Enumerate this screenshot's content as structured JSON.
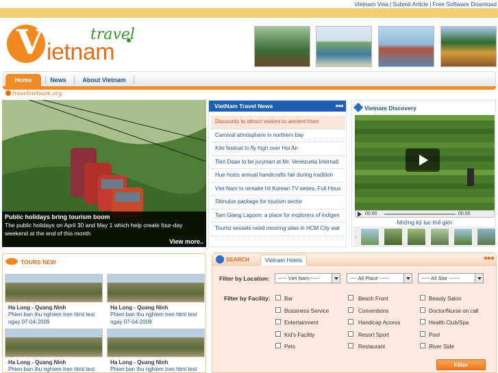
{
  "top_links": [
    "Vietnam Visa",
    "Submit Article",
    "Free Software Download"
  ],
  "top_link_separator": "|",
  "logo": {
    "letter": "V",
    "word": "ietnam",
    "tagline": "travel"
  },
  "nav": {
    "items": [
      "Home",
      "News",
      "About Vietnam"
    ],
    "site_url": "travelvietnam.org"
  },
  "featured": {
    "title": "Public holidays bring tourism boom",
    "description": "The public holidays on April 30 and May 1 which help create four-day weekend at the end of this month",
    "more": "View more.."
  },
  "news": {
    "title": "VietNam Travel News",
    "dots": "●●●",
    "items": [
      "Discounts to attract visitors to ancient town",
      "Carnival atmosphere in northern bay",
      "Kite festival to fly high over Hoi An",
      "Tien Doan to be juryman at Mr. Venezuela Internati",
      "Hue hosts annual handicrafts fair during tradition",
      "Viet Nam to remake hit Korean TV series, Full Hous",
      "Stimulus package for tourism sector",
      "Tam Giang Lagoon: a place for explorers of indigen",
      "Tourist vessels need mooring sites in HCM City wat"
    ]
  },
  "discovery": {
    "title": "Vietnam Discovery",
    "time_start": "00:00",
    "time_end": "00:00",
    "caption": "Những kỳ lục thế giới",
    "thumb_prev": "‹",
    "thumb_next": "›"
  },
  "tours": {
    "title": "TOURS NEW",
    "items": [
      {
        "title": "Ha Long - Quang Ninh",
        "desc": "Phien ban thu nghiem tren html test ngay 07-04-2009"
      },
      {
        "title": "Ha Long - Quang Ninh",
        "desc": "Phien ban thu nghiem tren html test ngay 07-04-2009"
      },
      {
        "title": "Ha Long - Quang Ninh",
        "desc": "Phien ban thu nghiem tren html test"
      },
      {
        "title": "Ha Long - Quang Ninh",
        "desc": "Phien ban thu nghiem tren html test"
      }
    ]
  },
  "search": {
    "tab_search": "SEARCH",
    "tab_hotels": "Vietnam Hotels",
    "dots": "●●●",
    "filter_location_label": "Filter by Location:",
    "filter_facility_label": "Filter by Facility:",
    "selects": [
      "----- Viet Nam------",
      "---- All Place ------",
      "----- All Star ------"
    ],
    "facilities": [
      [
        "Bar",
        "Beach Front",
        "Beauty Salon"
      ],
      [
        "Bussiness Service",
        "Conventions",
        "Doctor/Nurse on call"
      ],
      [
        "Entertainment",
        "Handicap Access",
        "Health Club/Spa"
      ],
      [
        "Kid's Facility",
        "Resort Sport",
        "Pool"
      ],
      [
        "Pets",
        "Restaurant",
        "River Side"
      ]
    ],
    "filter_button": "Filter"
  },
  "colors": {
    "accent": "#f08a24",
    "link": "#1a4f8b",
    "news_header": "#1f5fb0",
    "topbar": "#f6ce72"
  }
}
